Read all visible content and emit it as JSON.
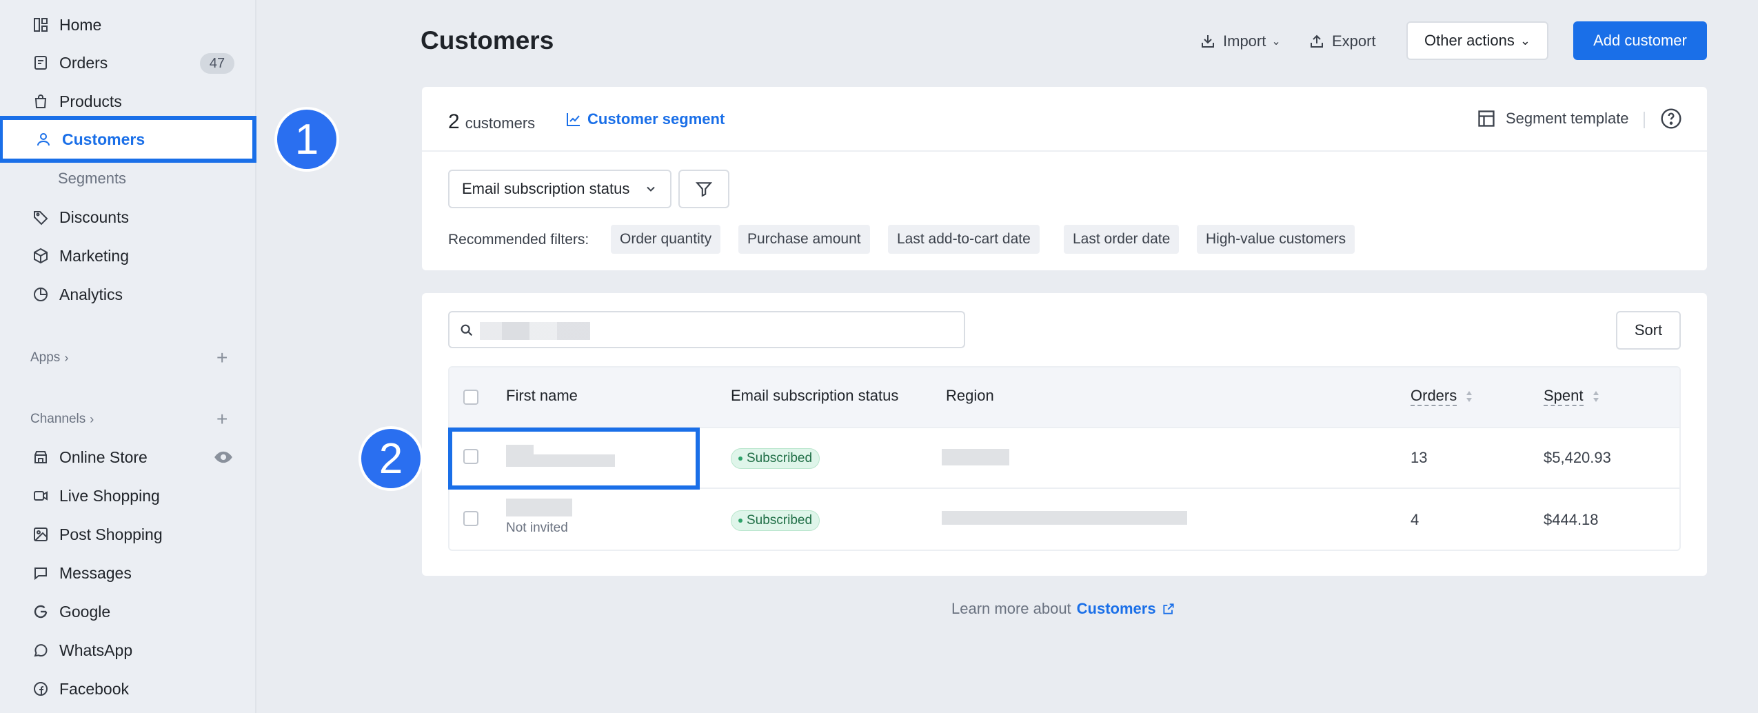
{
  "sidebar": {
    "items": [
      {
        "label": "Home",
        "icon": "dashboard-icon"
      },
      {
        "label": "Orders",
        "icon": "orders-icon",
        "badge": "47"
      },
      {
        "label": "Products",
        "icon": "bag-icon"
      },
      {
        "label": "Customers",
        "icon": "user-icon",
        "active": true
      },
      {
        "label": "Segments"
      },
      {
        "label": "Discounts",
        "icon": "tag-icon"
      },
      {
        "label": "Marketing",
        "icon": "cube-icon"
      },
      {
        "label": "Analytics",
        "icon": "pie-chart-icon"
      }
    ],
    "apps_label": "Apps",
    "channels_label": "Channels",
    "channels": [
      {
        "label": "Online Store",
        "icon": "store-icon"
      },
      {
        "label": "Live Shopping",
        "icon": "video-icon"
      },
      {
        "label": "Post Shopping",
        "icon": "image-icon"
      },
      {
        "label": "Messages",
        "icon": "chat-icon"
      },
      {
        "label": "Google",
        "icon": "google-icon"
      },
      {
        "label": "WhatsApp",
        "icon": "whatsapp-icon"
      },
      {
        "label": "Facebook",
        "icon": "facebook-icon"
      }
    ]
  },
  "steps": [
    "1",
    "2"
  ],
  "header": {
    "title": "Customers",
    "import_label": "Import",
    "export_label": "Export",
    "other_actions_label": "Other actions",
    "add_customer_label": "Add customer"
  },
  "segment": {
    "count": "2",
    "count_suffix": "customers",
    "segment_link": "Customer segment",
    "template_label": "Segment template",
    "filter_select": "Email subscription status",
    "recommended_label": "Recommended filters:",
    "recommended": [
      "Order quantity",
      "Purchase amount",
      "Last add-to-cart date",
      "Last order date",
      "High-value customers"
    ]
  },
  "table": {
    "sort_label": "Sort",
    "columns": [
      "First name",
      "Email subscription status",
      "Region",
      "Orders",
      "Spent"
    ],
    "rows": [
      {
        "status": "Subscribed",
        "orders": "13",
        "spent": "$5,420.93",
        "note": ""
      },
      {
        "status": "Subscribed",
        "orders": "4",
        "spent": "$444.18",
        "note": "Not invited"
      }
    ]
  },
  "footer": {
    "learn_prefix": "Learn more about",
    "learn_link": "Customers"
  },
  "colors": {
    "accent": "#1a6fe8",
    "background": "#e9ecf1",
    "subscribed_badge": "#dff5ea"
  }
}
